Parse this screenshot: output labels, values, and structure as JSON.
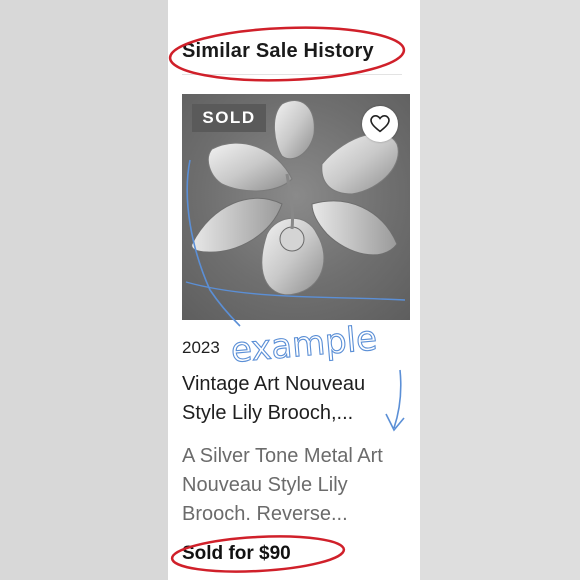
{
  "section": {
    "title": "Similar Sale History"
  },
  "listing": {
    "badge": "SOLD",
    "year": "2023",
    "title": "Vintage Art Nouveau Style Lily Brooch,...",
    "description": "A Silver Tone Metal Art Nouveau Style Lily Brooch. Reverse...",
    "price": "Sold for $90"
  },
  "annotation": {
    "handwritten_text": "example"
  },
  "colors": {
    "badge_bg": "#5a5a5a",
    "circle_red": "#d0202a",
    "pen_blue": "#5b8fd6"
  },
  "icons": {
    "favorite": "heart-outline-icon"
  }
}
